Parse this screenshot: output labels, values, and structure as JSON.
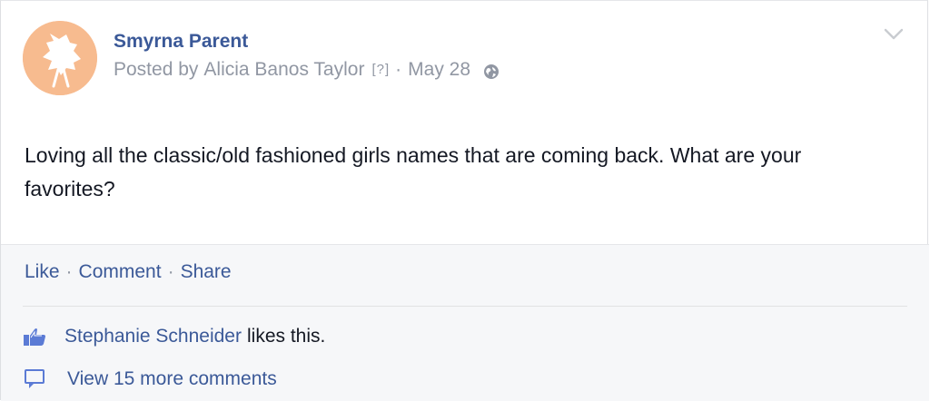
{
  "post": {
    "page_name": "Smyrna Parent",
    "posted_by_label": "Posted by",
    "author": "Alicia Banos Taylor",
    "help_marker": "[?]",
    "separator": "·",
    "date": "May 28",
    "privacy_icon": "globe-icon",
    "options_icon": "chevron-down-icon",
    "text": "Loving all the classic/old fashioned girls names that are coming back. What are your favorites?"
  },
  "actions": {
    "like": "Like",
    "comment": "Comment",
    "share": "Share",
    "separator": "·"
  },
  "likes": {
    "icon": "thumbs-up-icon",
    "liker": "Stephanie Schneider",
    "suffix": "likes this."
  },
  "comments": {
    "icon": "comment-bubble-icon",
    "view_more": "View 15 more comments"
  },
  "colors": {
    "link": "#3b5998",
    "meta": "#9197a3",
    "text": "#141823",
    "footer_bg": "#f6f7f9",
    "avatar_bg": "#f7bb8f"
  }
}
